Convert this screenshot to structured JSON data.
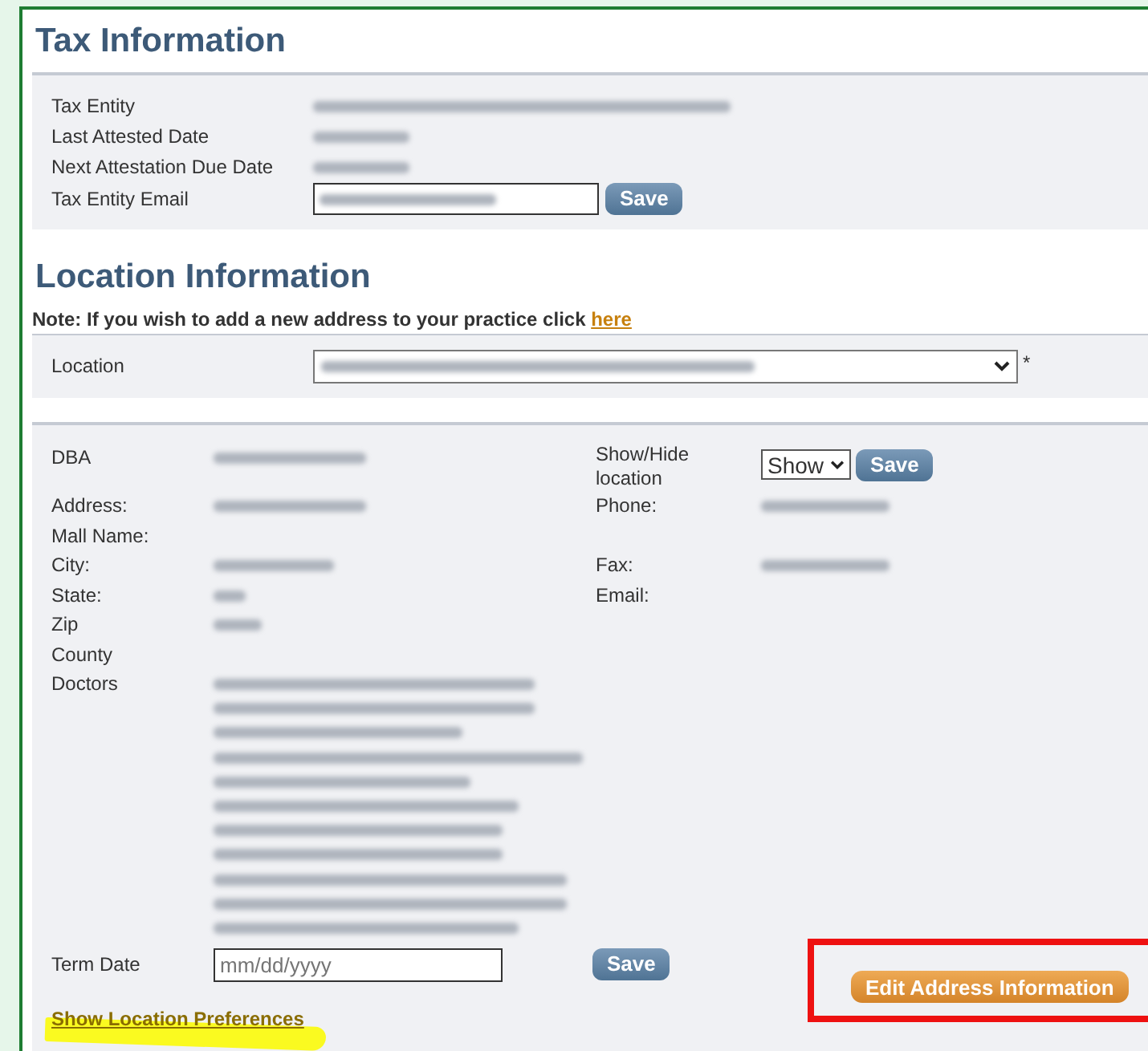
{
  "tax_information": {
    "title": "Tax Information",
    "fields": [
      {
        "label": "Tax Entity",
        "kind": "redacted"
      },
      {
        "label": "Last Attested Date",
        "kind": "redacted"
      },
      {
        "label": "Next Attestation Due Date",
        "kind": "redacted"
      },
      {
        "label": "Tax Entity Email",
        "kind": "input"
      }
    ],
    "save_button": "Save"
  },
  "location_information": {
    "title": "Location Information",
    "note": "Note: If you wish to add a new address to your practice click",
    "note_link": "here",
    "location_label": "Location",
    "required_mark": "*"
  },
  "location_details": {
    "rows": [
      {
        "label": "DBA",
        "kind": "redacted",
        "right": {
          "label": "Show/Hide location",
          "kind": "select",
          "value": "Show",
          "button": "Save"
        }
      },
      {
        "label": "Address:",
        "kind": "redacted",
        "right": {
          "label": "Phone:",
          "kind": "redacted"
        }
      },
      {
        "label": "Mall Name:",
        "kind": "none"
      },
      {
        "label": "City:",
        "kind": "redacted",
        "right": {
          "label": "Fax:",
          "kind": "redacted"
        }
      },
      {
        "label": "State:",
        "kind": "redacted",
        "right": {
          "label": "Email:",
          "kind": "none"
        }
      },
      {
        "label": "Zip",
        "kind": "redacted"
      },
      {
        "label": "County",
        "kind": "none"
      },
      {
        "label": "Doctors",
        "kind": "redacted_list"
      }
    ],
    "term_date": {
      "label": "Term Date",
      "placeholder": "mm/dd/yyyy",
      "button": "Save"
    },
    "edit_button": "Edit Address Information",
    "preferences_link": "Show Location Preferences"
  }
}
